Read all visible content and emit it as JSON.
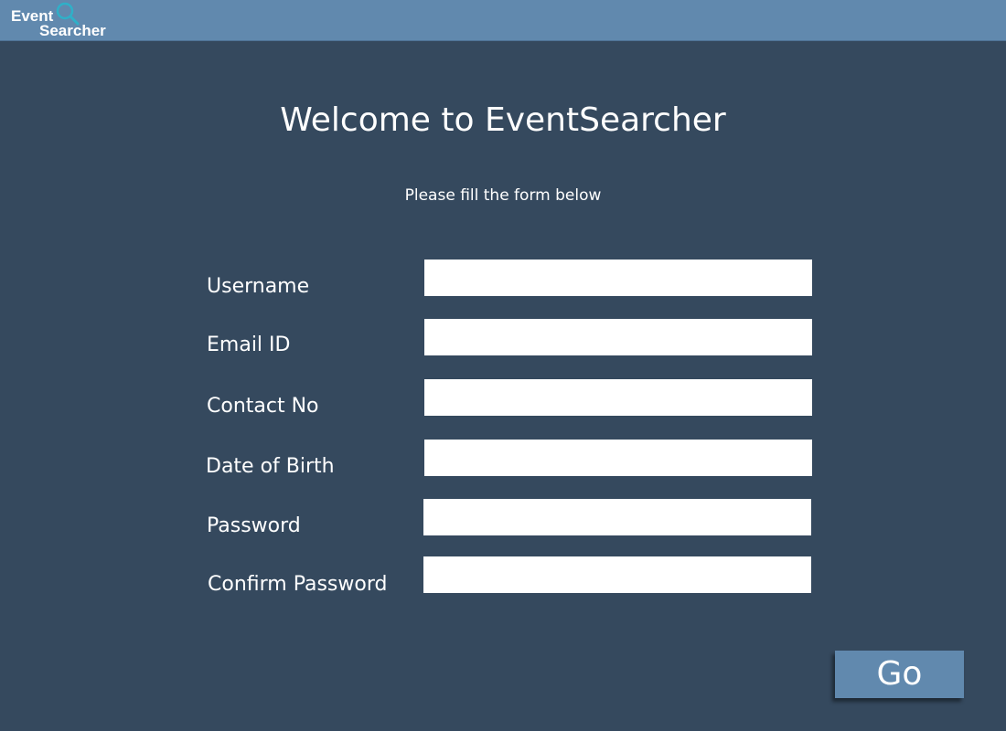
{
  "brand": {
    "logo_line1": "Event",
    "logo_line2": "Searcher",
    "logo_icon": "magnifier-icon"
  },
  "page": {
    "title": "Welcome to EventSearcher",
    "subtitle": "Please fill the form below"
  },
  "form": {
    "fields": [
      {
        "label": "Username",
        "value": "",
        "placeholder": ""
      },
      {
        "label": "Email ID",
        "value": "",
        "placeholder": ""
      },
      {
        "label": "Contact No",
        "value": "",
        "placeholder": ""
      },
      {
        "label": "Date of Birth",
        "value": "",
        "placeholder": ""
      },
      {
        "label": "Password",
        "value": "",
        "placeholder": ""
      },
      {
        "label": "Confirm Password",
        "value": "",
        "placeholder": ""
      }
    ],
    "submit_label": "Go"
  },
  "colors": {
    "background": "#35495e",
    "topbar": "#6189ae",
    "button": "#6189ae",
    "text": "#ffffff",
    "field": "#ffffff",
    "logo_icon_accent": "#2fb0c8"
  }
}
